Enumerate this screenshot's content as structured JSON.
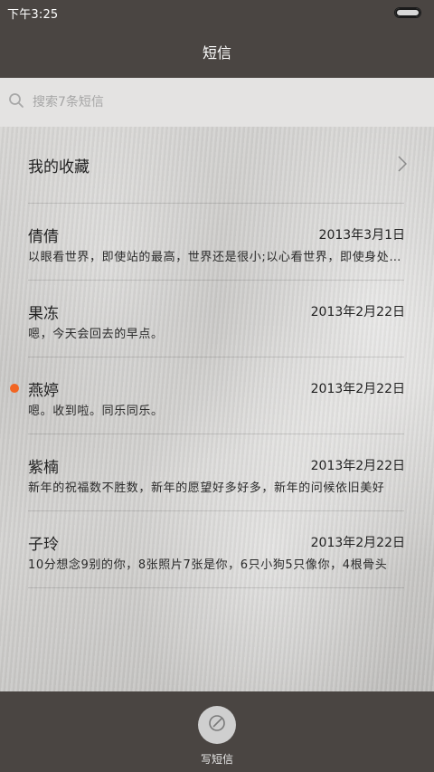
{
  "status": {
    "time": "下午3:25"
  },
  "header": {
    "title": "短信"
  },
  "search": {
    "placeholder": "搜索7条短信"
  },
  "favorites": {
    "label": "我的收藏"
  },
  "threads": [
    {
      "name": "倩倩",
      "date": "2013年3月1日",
      "preview": "以眼看世界，即使站的最高，世界还是很小;以心看世界，即使身处最低处，世界也是很大",
      "unread": false
    },
    {
      "name": "果冻",
      "date": "2013年2月22日",
      "preview": "嗯，今天会回去的早点。",
      "unread": false
    },
    {
      "name": "燕婷",
      "date": "2013年2月22日",
      "preview": "嗯。收到啦。同乐同乐。",
      "unread": true
    },
    {
      "name": "紫楠",
      "date": "2013年2月22日",
      "preview": "新年的祝福数不胜数，新年的愿望好多好多，新年的问候依旧美好",
      "unread": false
    },
    {
      "name": "子玲",
      "date": "2013年2月22日",
      "preview": "10分想念9别的你，8张照片7张是你，6只小狗5只像你，4根骨头",
      "unread": false
    }
  ],
  "bottom": {
    "compose_label": "写短信"
  },
  "colors": {
    "bar_bg": "#4a4542",
    "unread_dot": "#f26522",
    "search_bg": "#e4e3e2"
  },
  "icons": {
    "search": "search-icon",
    "chevron": "chevron-right-icon",
    "compose": "compose-icon"
  }
}
